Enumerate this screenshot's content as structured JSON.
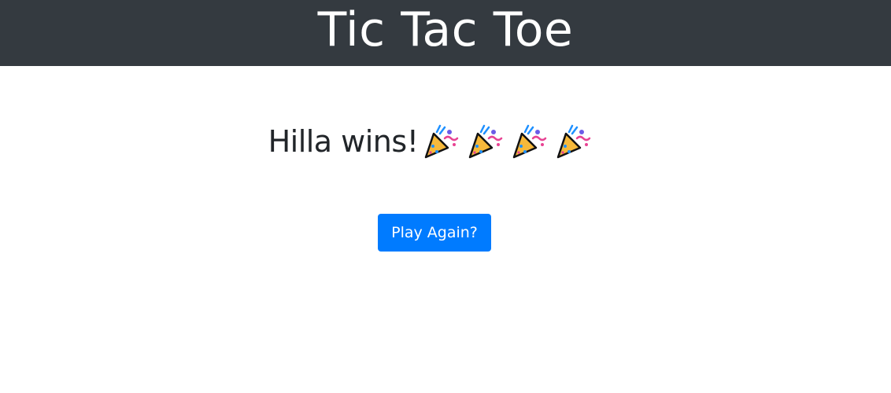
{
  "header": {
    "title": "Tic Tac Toe"
  },
  "result": {
    "message": "Hilla wins!",
    "celebration_icons": [
      "party-popper-icon",
      "party-popper-icon",
      "party-popper-icon",
      "party-popper-icon"
    ]
  },
  "actions": {
    "play_again_label": "Play Again?"
  },
  "colors": {
    "header_bg": "#343a40",
    "primary": "#007bff",
    "text": "#212529"
  }
}
